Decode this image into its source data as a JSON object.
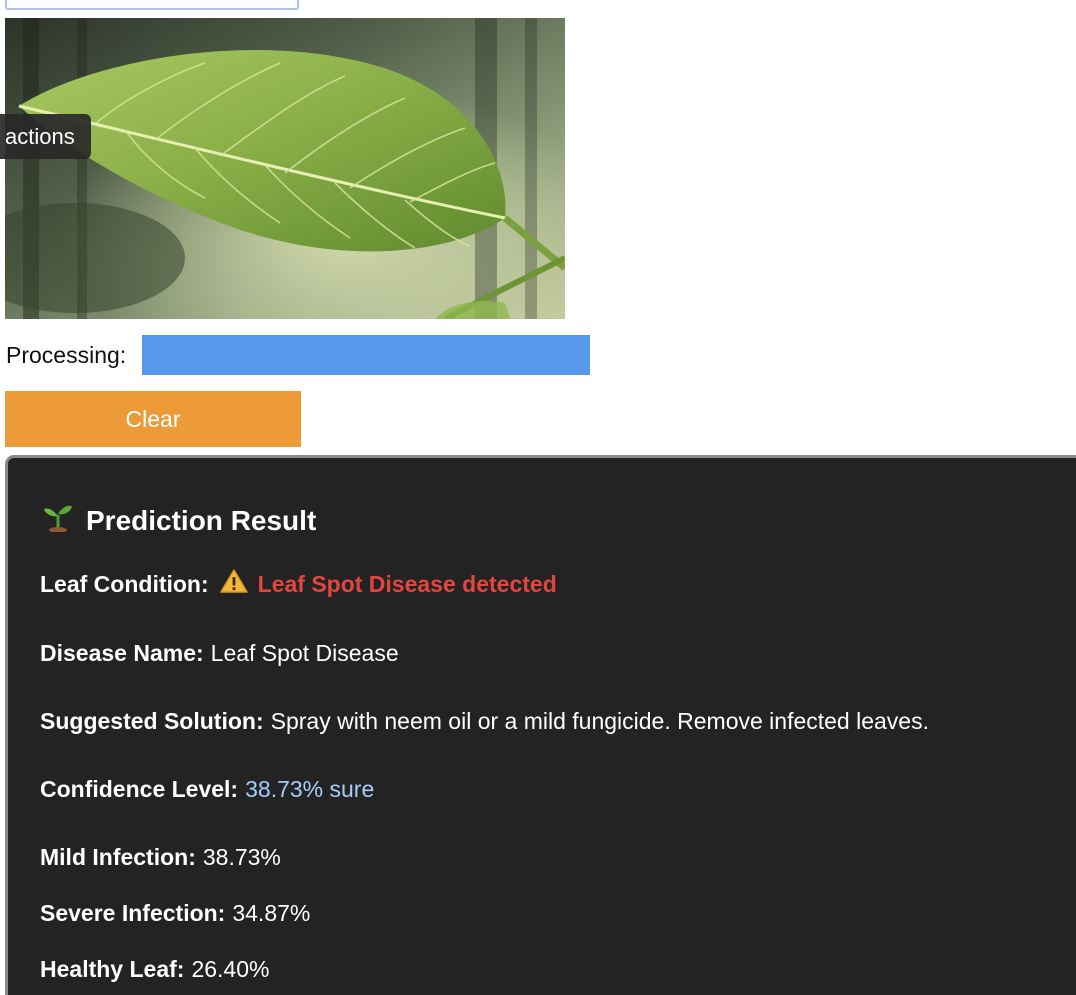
{
  "upload": {
    "actions_label": "actions"
  },
  "processing": {
    "label": "Processing:",
    "progress_percent": 100
  },
  "clear_label": "Clear",
  "result": {
    "title": "Prediction Result",
    "title_icon": "sprout-icon",
    "leaf_condition": {
      "label": "Leaf Condition:",
      "icon": "warning-icon",
      "value": "Leaf Spot Disease detected",
      "color": "#e2473f"
    },
    "disease_name": {
      "label": "Disease Name:",
      "value": "Leaf Spot Disease"
    },
    "solution": {
      "label": "Suggested Solution:",
      "value": "Spray with neem oil or a mild fungicide. Remove infected leaves."
    },
    "confidence": {
      "label": "Confidence Level:",
      "value": "38.73% sure",
      "color": "#a7cdfb"
    },
    "probabilities": [
      {
        "label": "Mild Infection:",
        "value": "38.73%"
      },
      {
        "label": "Severe Infection:",
        "value": "34.87%"
      },
      {
        "label": "Healthy Leaf:",
        "value": "26.40%"
      }
    ]
  },
  "colors": {
    "progress": "#5798ec",
    "clear_button": "#ec9b38",
    "card_background": "#232323"
  }
}
